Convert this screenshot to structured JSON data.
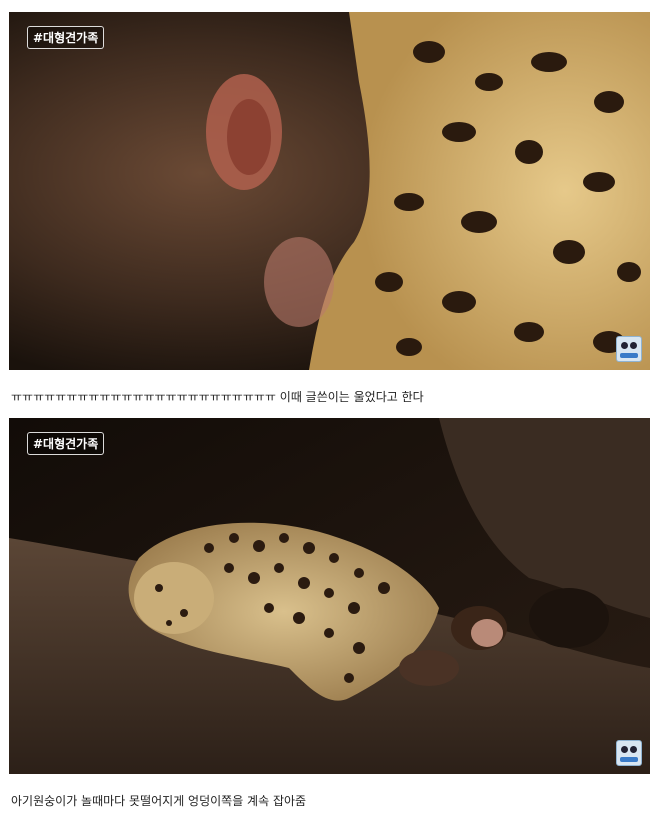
{
  "frames": [
    {
      "tag": "#대형견가족"
    },
    {
      "tag": "#대형견가족"
    }
  ],
  "captions": [
    "ㅠㅠㅠㅠㅠㅠㅠㅠㅠㅠㅠㅠㅠㅠㅠㅠㅠㅠㅠㅠㅠㅠㅠㅠ 이때 글쓴이는 울었다고 한다",
    "아기원숭이가 놀때마다 못떨어지게 엉덩이쪽을 계속 잡아줌"
  ]
}
